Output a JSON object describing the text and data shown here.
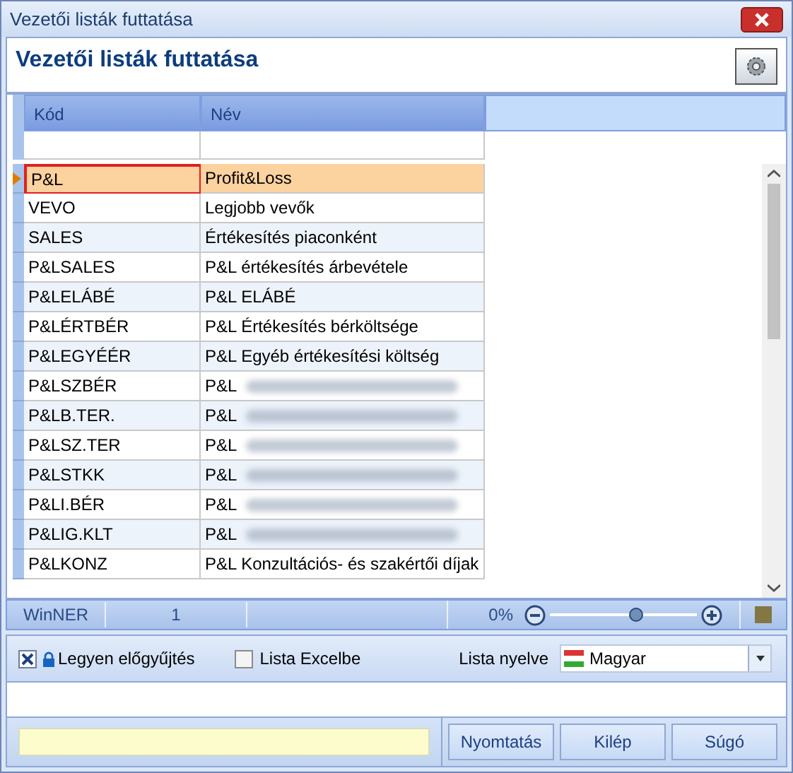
{
  "window": {
    "title": "Vezetői listák futtatása"
  },
  "header": {
    "title": "Vezetői listák futtatása"
  },
  "table": {
    "columns": [
      "Kód",
      "Név"
    ],
    "rows": [
      {
        "code": "P&L",
        "name": "Profit&Loss",
        "selected": true,
        "blurred": false
      },
      {
        "code": "VEVO",
        "name": "Legjobb vevők",
        "selected": false,
        "blurred": false
      },
      {
        "code": "SALES",
        "name": "Értékesítés piaconként",
        "selected": false,
        "blurred": false
      },
      {
        "code": "P&LSALES",
        "name": "P&L értékesítés árbevétele",
        "selected": false,
        "blurred": false
      },
      {
        "code": "P&LELÁBÉ",
        "name": "P&L ELÁBÉ",
        "selected": false,
        "blurred": false
      },
      {
        "code": "P&LÉRTBÉR",
        "name": "P&L Értékesítés bérköltsége",
        "selected": false,
        "blurred": false
      },
      {
        "code": "P&LEGYÉÉR",
        "name": "P&L Egyéb értékesítési költség",
        "selected": false,
        "blurred": false
      },
      {
        "code": "P&LSZBÉR",
        "name": "P&L",
        "selected": false,
        "blurred": true
      },
      {
        "code": "P&LB.TER.",
        "name": "P&L",
        "selected": false,
        "blurred": true
      },
      {
        "code": "P&LSZ.TER",
        "name": "P&L",
        "selected": false,
        "blurred": true
      },
      {
        "code": "P&LSTKK",
        "name": "P&L",
        "selected": false,
        "blurred": true
      },
      {
        "code": "P&LI.BÉR",
        "name": "P&L",
        "selected": false,
        "blurred": true
      },
      {
        "code": "P&LIG.KLT",
        "name": "P&L",
        "selected": false,
        "blurred": true
      },
      {
        "code": "P&LKONZ",
        "name": "P&L Konzultációs- és szakértői díjak",
        "selected": false,
        "blurred": false
      }
    ]
  },
  "status_bar": {
    "app": "WinNER",
    "count": "1",
    "zoom": "0%",
    "zoom_level": {
      "level": 0.6
    }
  },
  "options": {
    "precollect": {
      "label": "Legyen előgyűjtés",
      "checked": true
    },
    "excel": {
      "label": "Lista Excelbe",
      "checked": false
    },
    "language_label": "Lista nyelve",
    "language": "Magyar"
  },
  "buttons": [
    "Nyomtatás",
    "Kilép",
    "Súgó"
  ]
}
